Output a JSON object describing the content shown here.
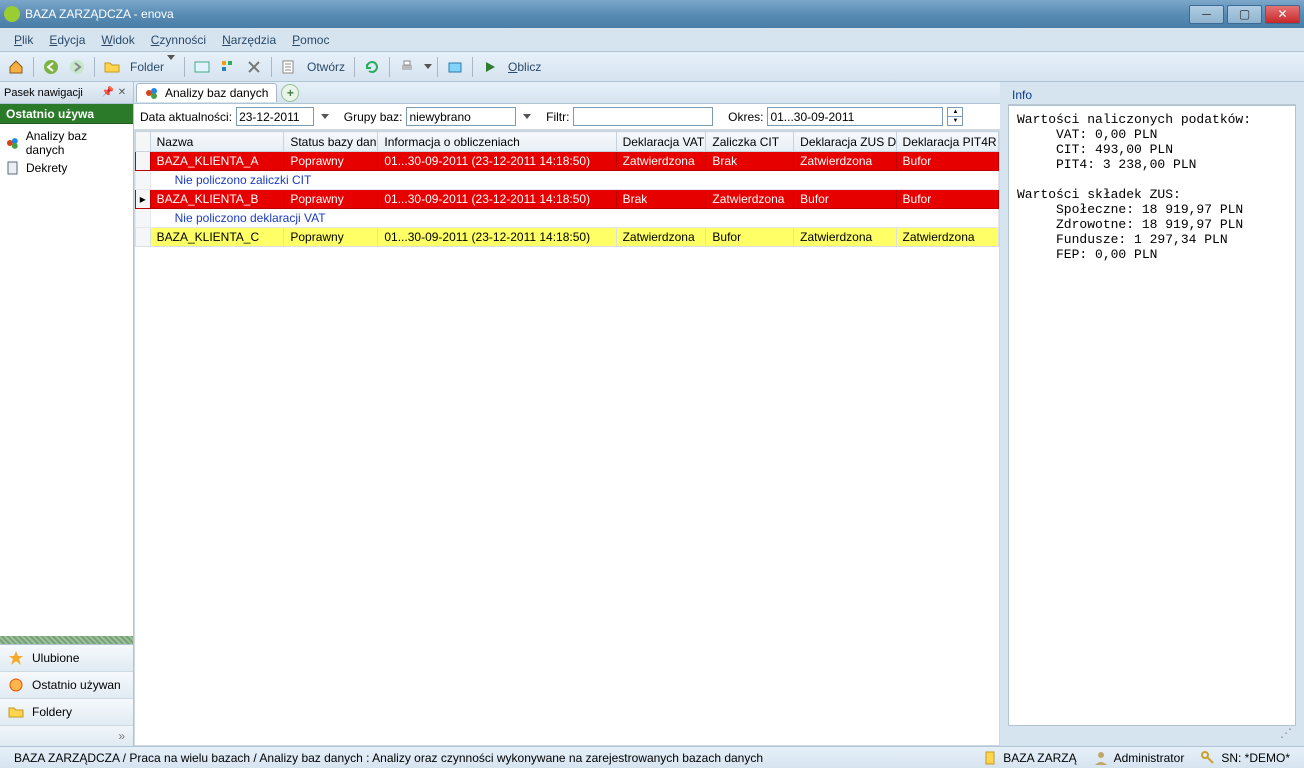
{
  "window": {
    "title": "BAZA ZARZĄDCZA - enova"
  },
  "menu": {
    "plik": "Plik",
    "edycja": "Edycja",
    "widok": "Widok",
    "czynnosci": "Czynności",
    "narzedzia": "Narzędzia",
    "pomoc": "Pomoc"
  },
  "toolbar": {
    "folder": "Folder",
    "otworz": "Otwórz",
    "oblicz": "Oblicz"
  },
  "nav": {
    "header": "Pasek nawigacji",
    "section": "Ostatnio używa",
    "items": [
      "Analizy baz danych",
      "Dekrety"
    ],
    "bottom": {
      "ulubione": "Ulubione",
      "ostatnio": "Ostatnio używan",
      "foldery": "Foldery"
    }
  },
  "tab": {
    "label": "Analizy baz danych"
  },
  "filter": {
    "data_label": "Data aktualności:",
    "data_value": "23-12-2011",
    "grupy_label": "Grupy baz:",
    "grupy_value": "niewybrano",
    "filtr_label": "Filtr:",
    "filtr_value": "",
    "okres_label": "Okres:",
    "okres_value": "01...30-09-2011"
  },
  "columns": {
    "nazwa": "Nazwa",
    "status": "Status bazy dan",
    "info": "Informacja o obliczeniach",
    "vat": "Deklaracja VAT",
    "cit": "Zaliczka CIT",
    "zus": "Deklaracja ZUS DF",
    "pit": "Deklaracja PIT4R"
  },
  "rows": [
    {
      "type": "data",
      "color": "red",
      "selected": false,
      "nazwa": "BAZA_KLIENTA_A",
      "status": "Poprawny",
      "info": "01...30-09-2011 (23-12-2011 14:18:50)",
      "vat": "Zatwierdzona",
      "cit": "Brak",
      "zus": "Zatwierdzona",
      "pit": "Bufor"
    },
    {
      "type": "note",
      "text": "Nie policzono zaliczki CIT"
    },
    {
      "type": "data",
      "color": "red",
      "selected": true,
      "nazwa": "BAZA_KLIENTA_B",
      "status": "Poprawny",
      "info": "01...30-09-2011 (23-12-2011 14:18:50)",
      "vat": "Brak",
      "cit": "Zatwierdzona",
      "zus": "Bufor",
      "pit": "Bufor"
    },
    {
      "type": "note",
      "text": "Nie policzono deklaracji VAT"
    },
    {
      "type": "data",
      "color": "yellow",
      "selected": false,
      "nazwa": "BAZA_KLIENTA_C",
      "status": "Poprawny",
      "info": "01...30-09-2011 (23-12-2011 14:18:50)",
      "vat": "Zatwierdzona",
      "cit": "Bufor",
      "zus": "Zatwierdzona",
      "pit": "Zatwierdzona"
    }
  ],
  "info": {
    "title": "Info",
    "body": "Wartości naliczonych podatków:\n     VAT: 0,00 PLN\n     CIT: 493,00 PLN\n     PIT4: 3 238,00 PLN\n\nWartości składek ZUS:\n     Społeczne: 18 919,97 PLN\n     Zdrowotne: 18 919,97 PLN\n     Fundusze: 1 297,34 PLN\n     FEP: 0,00 PLN"
  },
  "status": {
    "left": "BAZA ZARZĄDCZA / Praca na wielu bazach / Analizy baz danych : Analizy oraz czynności wykonywane na zarejestrowanych bazach danych",
    "db": "BAZA ZARZĄ",
    "user": "Administrator",
    "sn": "SN: *DEMO*"
  }
}
